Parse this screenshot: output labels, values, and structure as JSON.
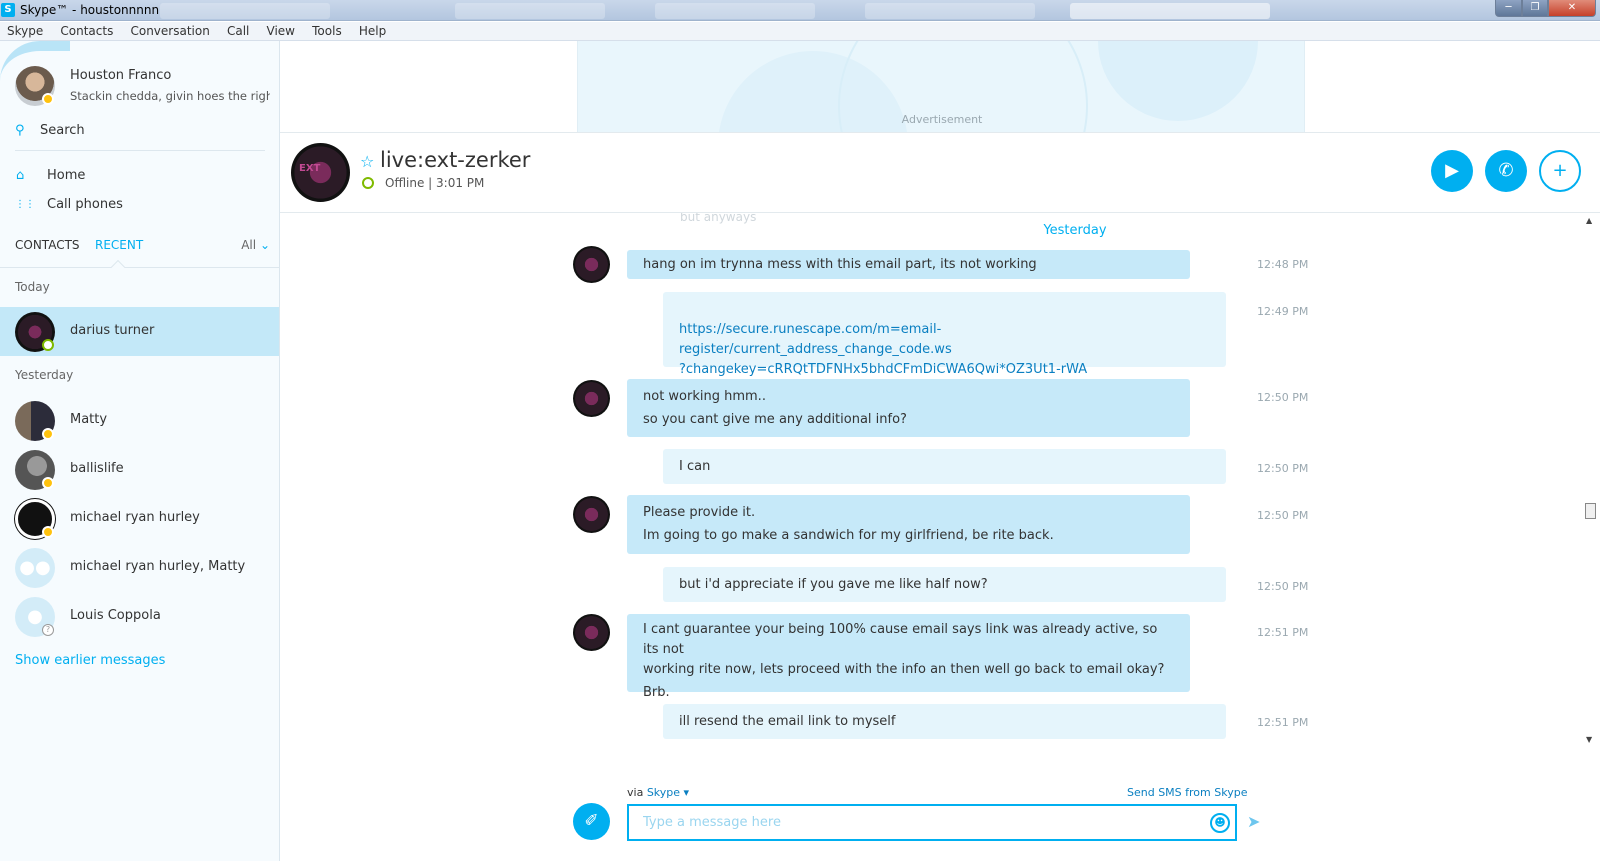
{
  "window": {
    "title": "Skype™ - houstonnnnn"
  },
  "menu": [
    "Skype",
    "Contacts",
    "Conversation",
    "Call",
    "View",
    "Tools",
    "Help"
  ],
  "profile": {
    "name": "Houston Franco",
    "mood": "Stackin chedda, givin hoes the righ..."
  },
  "nav": {
    "search": "Search",
    "home": "Home",
    "call_phones": "Call phones"
  },
  "tabs": {
    "contacts": "CONTACTS",
    "recent": "RECENT",
    "filter": "All"
  },
  "sections": {
    "today": "Today",
    "yesterday": "Yesterday"
  },
  "recent_contacts": [
    {
      "name": "darius turner",
      "status": "online",
      "selected": true
    },
    {
      "name": "Matty",
      "status": "away"
    },
    {
      "name": "ballislife",
      "status": "away"
    },
    {
      "name": "michael ryan hurley",
      "status": "away"
    },
    {
      "name": "michael ryan hurley, Matty",
      "status": "group"
    },
    {
      "name": "Louis Coppola",
      "status": "unknown"
    }
  ],
  "show_earlier": "Show earlier messages",
  "ad": {
    "label": "Advertisement"
  },
  "conversation": {
    "name": "live:ext-zerker",
    "status": "Offline | 3:01 PM"
  },
  "chat": {
    "ghost_text": "but anyways",
    "day_label": "Yesterday",
    "messages": [
      {
        "from": "them",
        "lines": [
          "hang on im trynna mess with this email part, its not working"
        ],
        "time": "12:48 PM"
      },
      {
        "from": "me",
        "lines": [
          "https://secure.runescape.com/m=email-register/current_address_change_code.ws",
          "?changekey=cRRQtTDFNHx5bhdCFmDiCWA6Qwi*OZ3Ut1-rWA"
        ],
        "time": "12:49 PM"
      },
      {
        "from": "them",
        "lines": [
          "not working hmm..",
          "so you cant give me any additional info?"
        ],
        "time": "12:50 PM"
      },
      {
        "from": "me",
        "lines": [
          "I can"
        ],
        "time": "12:50 PM"
      },
      {
        "from": "them",
        "lines": [
          "Please provide it.",
          "Im going to go make a sandwich for my girlfriend, be rite back."
        ],
        "time": "12:50 PM"
      },
      {
        "from": "me",
        "lines": [
          "but i'd appreciate if you gave me like half now?"
        ],
        "time": "12:50 PM"
      },
      {
        "from": "them",
        "lines": [
          "I cant guarantee your being 100% cause email says link was already active, so its not",
          "working rite now, lets proceed with the info an then well go back to email okay?",
          "Brb."
        ],
        "time": "12:51 PM"
      },
      {
        "from": "me",
        "lines": [
          "ill resend the email link to myself"
        ],
        "time": "12:51 PM"
      }
    ]
  },
  "compose": {
    "via_prefix": "via",
    "via_service": "Skype",
    "sms_link": "Send SMS from Skype",
    "placeholder": "Type a message here"
  },
  "colors": {
    "accent": "#00aff0",
    "bubble_them": "#c6e9f9",
    "bubble_me": "#e5f5fc",
    "selected_row": "#c3e8f8"
  },
  "icons": [
    "skype-logo-icon",
    "search-icon",
    "home-icon",
    "dialpad-icon",
    "chevron-down-icon",
    "star-icon",
    "video-call-icon",
    "phone-icon",
    "add-contact-icon",
    "paperclip-icon",
    "emoji-icon",
    "send-icon"
  ]
}
